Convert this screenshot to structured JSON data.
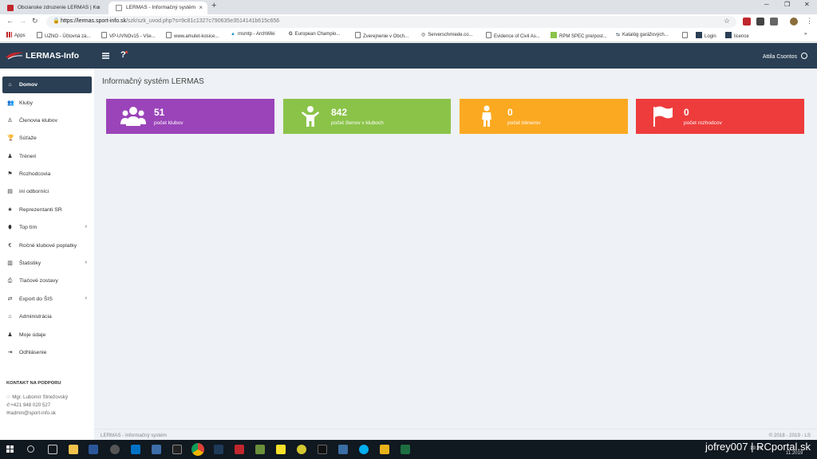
{
  "browser": {
    "tabs": [
      {
        "title": "Obcianske zdruzenie LERMAS | Ko"
      },
      {
        "title": "LERMAS - Informačný systém"
      }
    ],
    "url": {
      "host": "https://lermas.sport-info.sk",
      "path": "/szk/szk_uvod.php?s=9c81c1327c790635e3514141b615c656"
    },
    "bookmarks": [
      "Apps",
      "UZNO - Účtovná zá...",
      "VP-UVNOv15 - Vše...",
      "www.amulet-kosice...",
      "msmtp - ArchWiki",
      "European Champio...",
      "Zverejnenie v Obch...",
      "Serverschmiede.co...",
      "Evidence of Civil As...",
      "RPM SPEC pre/post...",
      "Katalóg garážových...",
      "Login",
      "licence"
    ]
  },
  "app": {
    "brand": "LERMAS-Info",
    "help_symbol": "?",
    "user_name": "Attila Csontos",
    "colors": {
      "header": "#2a3f54",
      "purple": "#9b44b9",
      "green": "#8bc349",
      "orange": "#fca922",
      "red": "#ee3c3c"
    }
  },
  "sidebar": {
    "items": [
      {
        "label": "Domov",
        "icon": "home-icon"
      },
      {
        "label": "Kluby",
        "icon": "users-icon"
      },
      {
        "label": "Členovia klubov",
        "icon": "child-icon"
      },
      {
        "label": "Súťaže",
        "icon": "trophy-icon"
      },
      {
        "label": "Tréneri",
        "icon": "male-icon"
      },
      {
        "label": "Rozhodcovia",
        "icon": "flag-icon"
      },
      {
        "label": "iní odborníci",
        "icon": "id-card-icon"
      },
      {
        "label": "Reprezentanti SR",
        "icon": "star-icon"
      },
      {
        "label": "Top tím",
        "icon": "football-icon"
      },
      {
        "label": "Ročné klubové poplatky",
        "icon": "euro-icon"
      },
      {
        "label": "Štatistiky",
        "icon": "bar-chart-icon"
      },
      {
        "label": "Tlačové zostavy",
        "icon": "print-icon"
      },
      {
        "label": "Export do ŠIS",
        "icon": "exchange-icon"
      },
      {
        "label": "Administrácia",
        "icon": "bank-icon"
      },
      {
        "label": "Moje údaje",
        "icon": "user-icon"
      },
      {
        "label": "Odhlásenie",
        "icon": "sign-out-icon"
      }
    ],
    "arrow": "›",
    "contact": {
      "title": "KONTAKT NA PODPORU",
      "name": "Mgr. Lubomír Striežovský",
      "phone": "+421 948 020 527",
      "email": "admin@sport-info.sk"
    }
  },
  "main": {
    "title": "Informačný systém LERMAS",
    "cards": [
      {
        "value": "51",
        "label": "počet klubov",
        "icon": "users-icon"
      },
      {
        "value": "842",
        "label": "počet členov v kluboch",
        "icon": "child-icon"
      },
      {
        "value": "0",
        "label": "počet trénerov",
        "icon": "male-icon"
      },
      {
        "value": "0",
        "label": "počet rozhodcov",
        "icon": "flag-icon"
      }
    ]
  },
  "footer": {
    "left": "LERMAS - Informačný systém",
    "right": "© 2018 - 2019 - LS"
  },
  "taskbar": {
    "time": "19:31",
    "date": "11.2019",
    "watermark": "jofrey007 | RCportal.sk"
  }
}
